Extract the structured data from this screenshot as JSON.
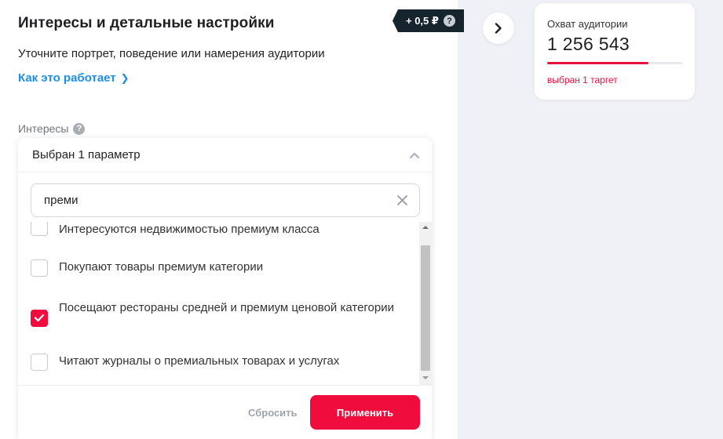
{
  "header": {
    "title": "Интересы и детальные настройки",
    "price_tag": "+ 0,5 ₽",
    "price_help": "?",
    "subtitle": "Уточните портрет, поведение или намерения аудитории",
    "how_link": "Как это работает",
    "how_link_chevron": "❯"
  },
  "interests": {
    "label": "Интересы",
    "help": "?",
    "selected_text": "Выбран 1 параметр",
    "search": {
      "value": "преми",
      "placeholder": ""
    },
    "items": [
      {
        "label": "Интересуются недвижимостью премиум класса",
        "checked": false
      },
      {
        "label": "Покупают товары премиум категории",
        "checked": false
      },
      {
        "label": "Посещают рестораны средней и премиум ценовой категории",
        "checked": true
      },
      {
        "label": "Читают журналы о премиальных товарах и услугах",
        "checked": false
      }
    ],
    "reset_label": "Сбросить",
    "apply_label": "Применить"
  },
  "reach": {
    "label": "Охват аудитории",
    "count": "1 256 543",
    "progress": 0.75,
    "status": "выбран 1 таргет"
  },
  "colors": {
    "accent": "#f00d3d",
    "link": "#1d8fe8",
    "price_tag_bg": "#16242e",
    "page_bg": "#f0f1f6"
  }
}
